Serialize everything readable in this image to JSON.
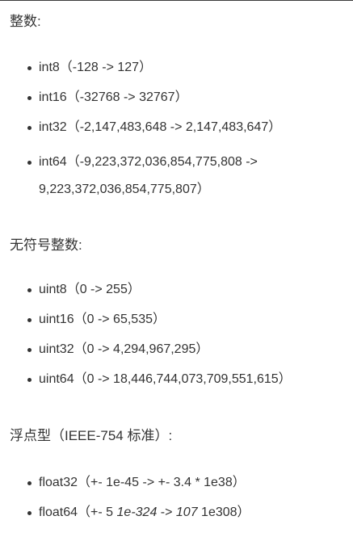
{
  "sections": {
    "integers": {
      "heading": "整数:",
      "items": [
        "int8（-128 -> 127）",
        "int16（-32768 -> 32767）",
        "int32（-2,147,483,648 -> 2,147,483,647）"
      ],
      "item_wrap": {
        "line1": "int64（-9,223,372,036,854,775,808 ->",
        "line2": "9,223,372,036,854,775,807）"
      }
    },
    "unsigned": {
      "heading": "无符号整数:",
      "items": [
        "uint8（0 -> 255）",
        "uint16（0 -> 65,535）",
        "uint32（0 -> 4,294,967,295）",
        "uint64（0 -> 18,446,744,073,709,551,615）"
      ]
    },
    "floats": {
      "heading": "浮点型（IEEE-754 标准）:",
      "items": [
        "float32（+- 1e-45 -> +- 3.4 * 1e38）"
      ],
      "float64": {
        "prefix": "float64（+- 5 ",
        "italic1": "1e-324",
        "middle": " -> ",
        "italic2": "107",
        "suffix": " 1e308）"
      }
    }
  }
}
